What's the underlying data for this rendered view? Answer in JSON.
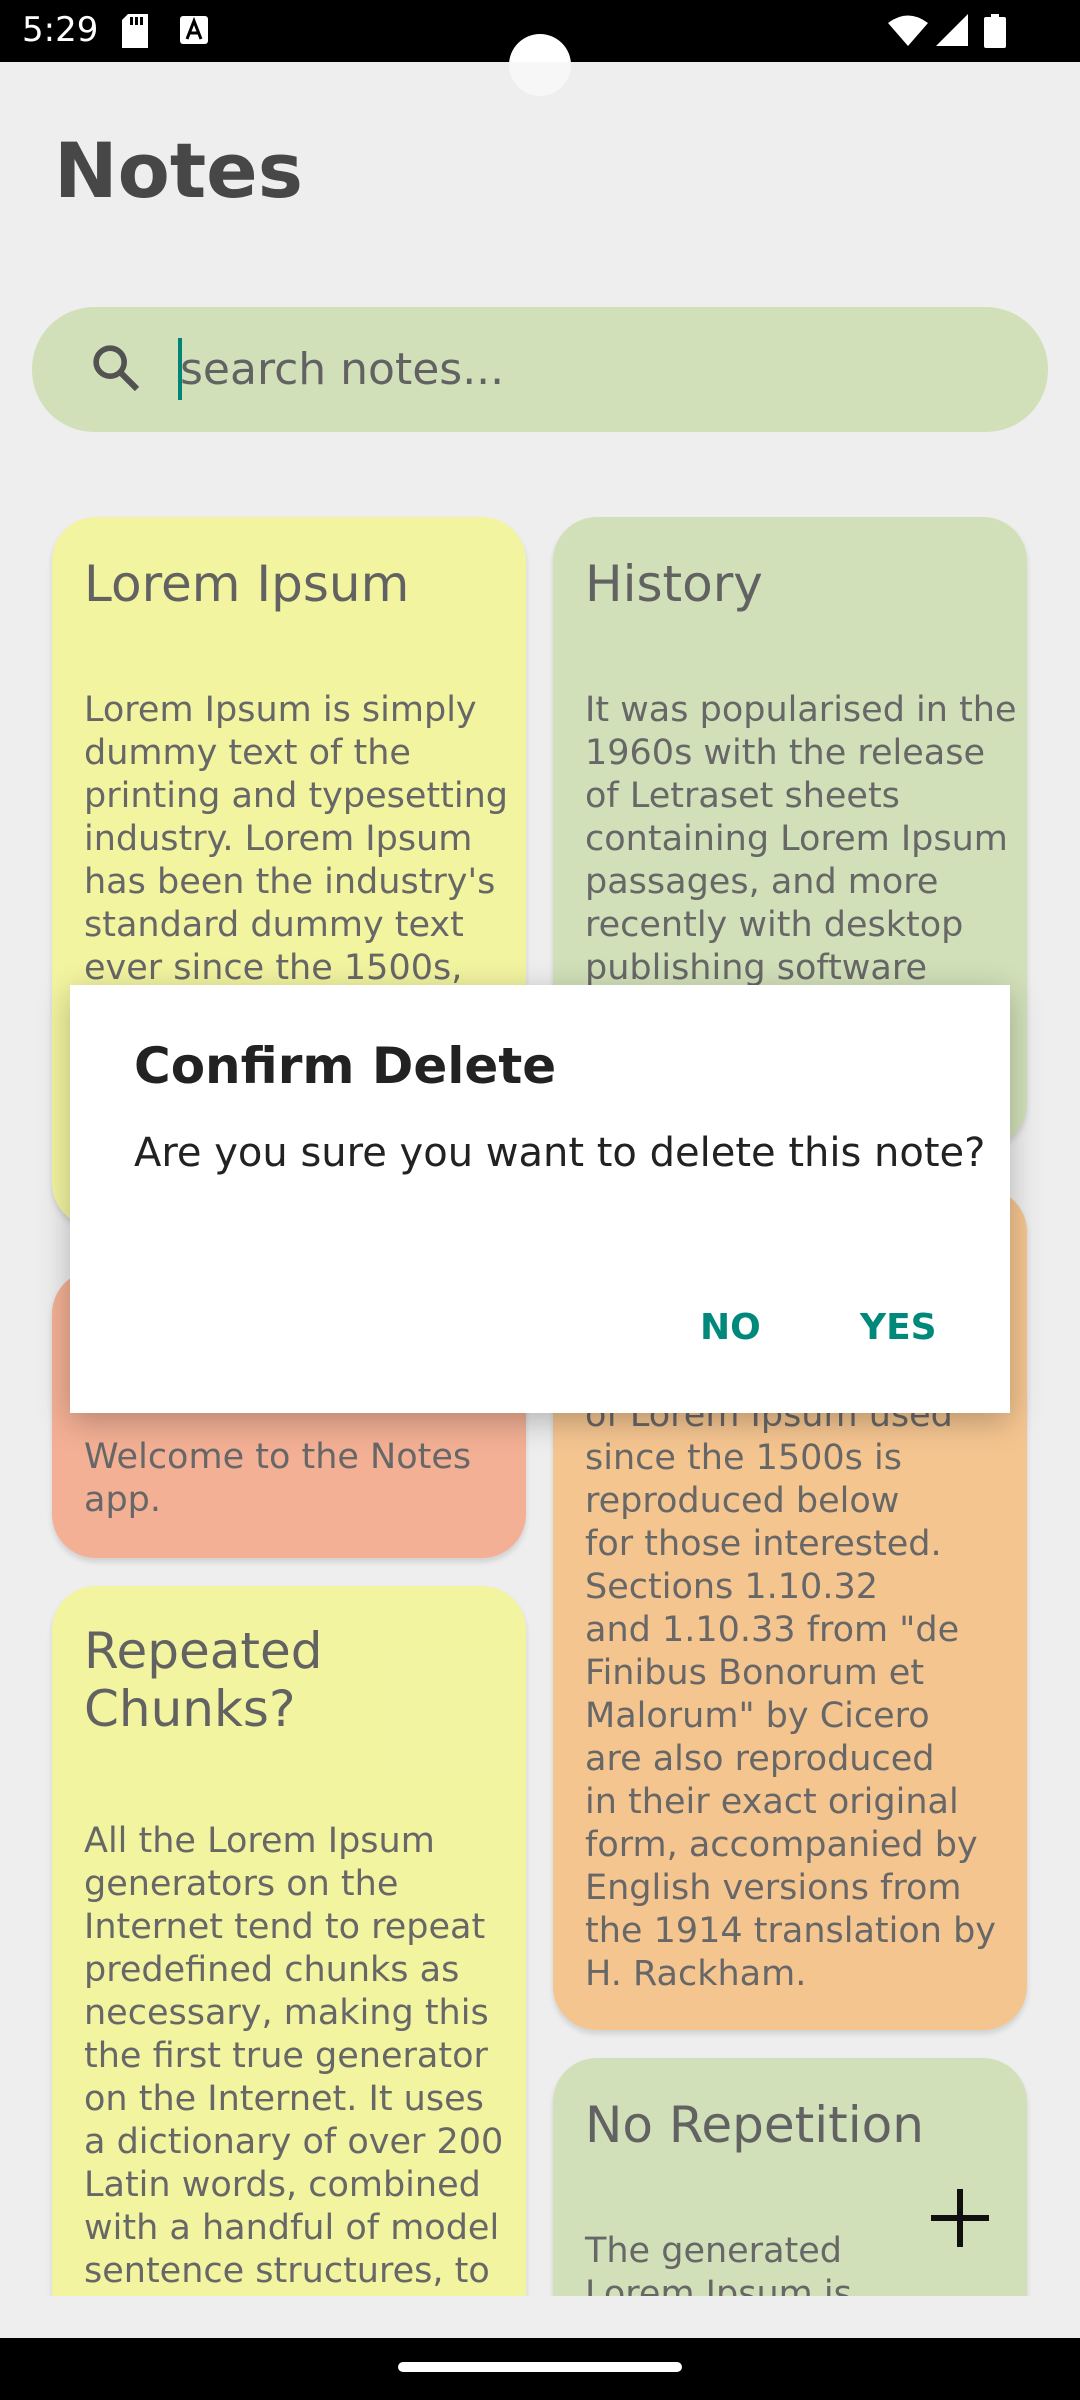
{
  "status_bar": {
    "time": "5:29",
    "icons": [
      "sd-card-icon",
      "a-box-icon",
      "wifi-icon",
      "signal-icon",
      "battery-icon"
    ]
  },
  "app": {
    "title": "Notes"
  },
  "search": {
    "placeholder": "search notes..."
  },
  "notes": [
    {
      "title": "Lorem Ipsum",
      "color": "#fafca6",
      "lines": [
        "Lorem Ipsum is simply",
        "dummy text of the",
        "printing and typesetting",
        "industry. Lorem Ipsum",
        "has been the industry's",
        "standard dummy text",
        "ever since the 1500s,"
      ]
    },
    {
      "title": "History",
      "color": "#d8e8bf",
      "lines": [
        "It was popularised in the",
        "1960s with the release",
        "of Letraset sheets",
        "containing Lorem Ipsum",
        "passages, and more",
        "recently with desktop",
        "publishing software"
      ]
    },
    {
      "title": "",
      "color": "#fbb69a",
      "lines": [
        "Welcome to the Notes",
        "app."
      ]
    },
    {
      "title": "",
      "color": "#fdcc95",
      "lines": [
        "of Lorem Ipsum used",
        "since the 1500s is",
        "reproduced below",
        "for those interested.",
        "Sections 1.10.32",
        "and 1.10.33 from \"de",
        "Finibus Bonorum et",
        "Malorum\" by Cicero",
        "are also reproduced",
        "in their exact original",
        "form, accompanied by",
        "English versions from",
        "the 1914 translation by",
        "H. Rackham."
      ]
    },
    {
      "title": "Repeated Chunks?",
      "title_lines": [
        "Repeated",
        "Chunks?"
      ],
      "color": "#fafca6",
      "lines": [
        "All the Lorem Ipsum",
        "generators on the",
        "Internet tend to repeat",
        "predefined chunks as",
        "necessary, making this",
        "the first true generator",
        "on the Internet. It uses",
        "a dictionary of over 200",
        "Latin words, combined",
        "with a handful of model",
        "sentence structures, to"
      ]
    },
    {
      "title": "No Repetition",
      "color": "#d8e8bf",
      "lines": [
        "The generated",
        "Lorem Ipsum is"
      ]
    }
  ],
  "dialog": {
    "title": "Confirm Delete",
    "message": "Are you sure you want to delete this note?",
    "no_label": "NO",
    "yes_label": "YES"
  }
}
